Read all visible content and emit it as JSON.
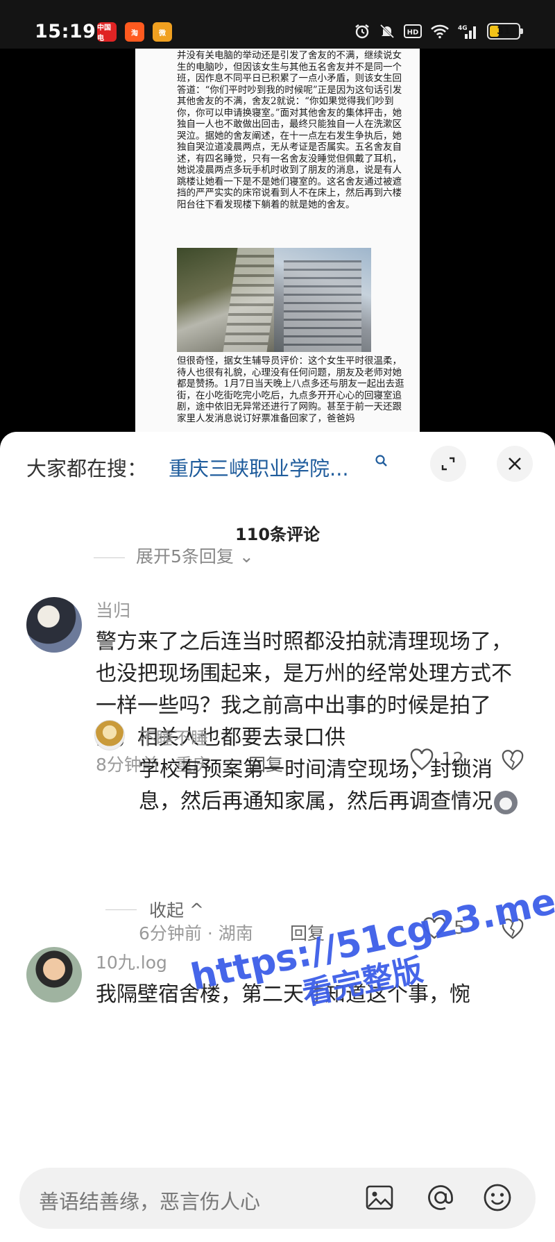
{
  "status_bar": {
    "time": "15:19",
    "apps": [
      "中国电",
      "淘",
      "微"
    ],
    "battery": "31",
    "battery_level": 0.31,
    "network": "4G"
  },
  "article": {
    "paragraph_1": "并没有关电脑的举动还是引发了舍友的不满，继续说女生的电脑吵，但因该女生与其他五名舍友并不是同一个班，因作息不同平日已积累了一点小矛盾，则该女生回答道：“你们平时吵到我的时候呢”正是因为这句话引发其他舍友的不满，舍友2就说：“你如果觉得我们吵到你，你可以申请换寝室。”面对其他舍友的集体抨击，她独自一人也不敢做出回击，最终只能独自一人在洗漱区哭泣。据她的舍友阐述，在十一点左右发生争执后，她独自哭泣道凌晨两点，无从考证是否属实。五名舍友自述，有四名睡觉，只有一名舍友没睡觉但佩戴了耳机，她说凌晨两点多玩手机时收到了朋友的消息，说是有人跳楼让她看一下是不是她们寝室的。这名舍友通过被遮挡的严严实实的床帘说看到人不在床上，然后再到六楼阳台往下看发现楼下躺着的就是她的舍友。",
    "paragraph_2": "但很奇怪，据女生辅导员评价：这个女生平时很温柔，待人也很有礼貌，心理没有任何问题，朋友及老师对她都是赞扬。1月7日当天晚上八点多还与朋友一起出去逛街，在小吃街吃完小吃后，九点多开开心心的回寝室追剧，途中依旧无异常还进行了网购。甚至于前一天还跟家里人发消息说订好票准备回家了，爸爸妈"
  },
  "search": {
    "prefix": "大家都在搜：",
    "query": "重庆三峡职业学院..."
  },
  "comments_header": {
    "count_label": "110条评论",
    "expand_replies": "展开5条回复"
  },
  "comments": [
    {
      "username": "当归",
      "text": "警方来了之后连当时照都没拍就清理现场了，也没把现场围起来，是万州的经常处理方式不一样一些吗？我之前高中出事的时候是拍了的，相关人也都要去录口供",
      "meta": "8分钟前 · 重庆",
      "reply_label": "回复",
      "likes": "12"
    },
    {
      "username": "不睡不睡",
      "text": "学校有预案第一时间清空现场，封锁消息，然后再通知家属，然后再调查情况",
      "meta": "6分钟前 · 湖南",
      "reply_label": "回复",
      "likes": "5"
    },
    {
      "username": "10九.log",
      "text": "我隔壁宿舍楼，第二天才知道这个事，惋"
    }
  ],
  "collapse_label": "收起",
  "watermark": {
    "line1": "https://51cg23.me",
    "line2": "看完整版"
  },
  "input_bar": {
    "placeholder": "善语结善缘，恶言伤人心"
  },
  "colors": {
    "search_query": "#1f5c9c",
    "watermark": "#3d5ee8",
    "battery": "#f2c218"
  }
}
